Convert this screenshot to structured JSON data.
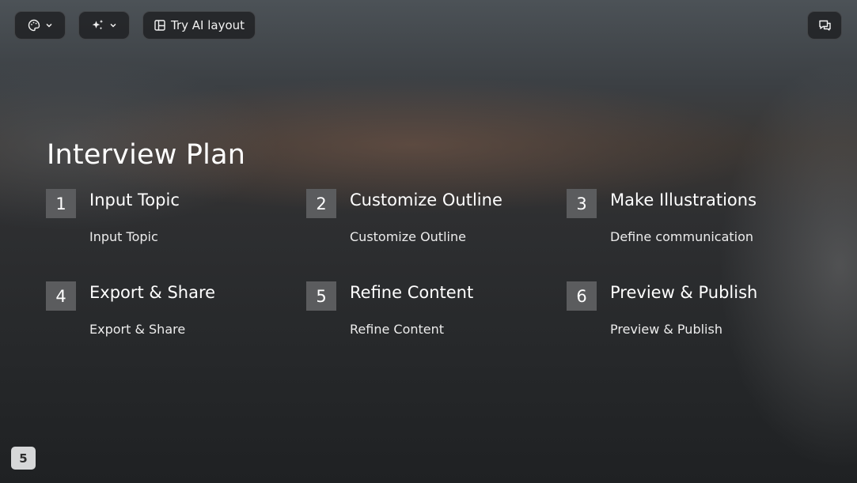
{
  "toolbar": {
    "theme_icon": "palette-icon",
    "ai_icon": "sparkles-icon",
    "layout_icon": "layout-icon",
    "layout_label": "Try AI layout",
    "comment_icon": "comment-icon"
  },
  "slide": {
    "title": "Interview Plan",
    "steps": [
      {
        "number": "1",
        "title": "Input Topic",
        "description": "Input Topic"
      },
      {
        "number": "2",
        "title": "Customize Outline",
        "description": "Customize Outline"
      },
      {
        "number": "3",
        "title": "Make Illustrations",
        "description": "Define communication"
      },
      {
        "number": "4",
        "title": "Export & Share",
        "description": "Export & Share"
      },
      {
        "number": "5",
        "title": "Refine Content",
        "description": "Refine Content"
      },
      {
        "number": "6",
        "title": "Preview & Publish",
        "description": "Preview & Publish"
      }
    ]
  },
  "page_number": "5"
}
